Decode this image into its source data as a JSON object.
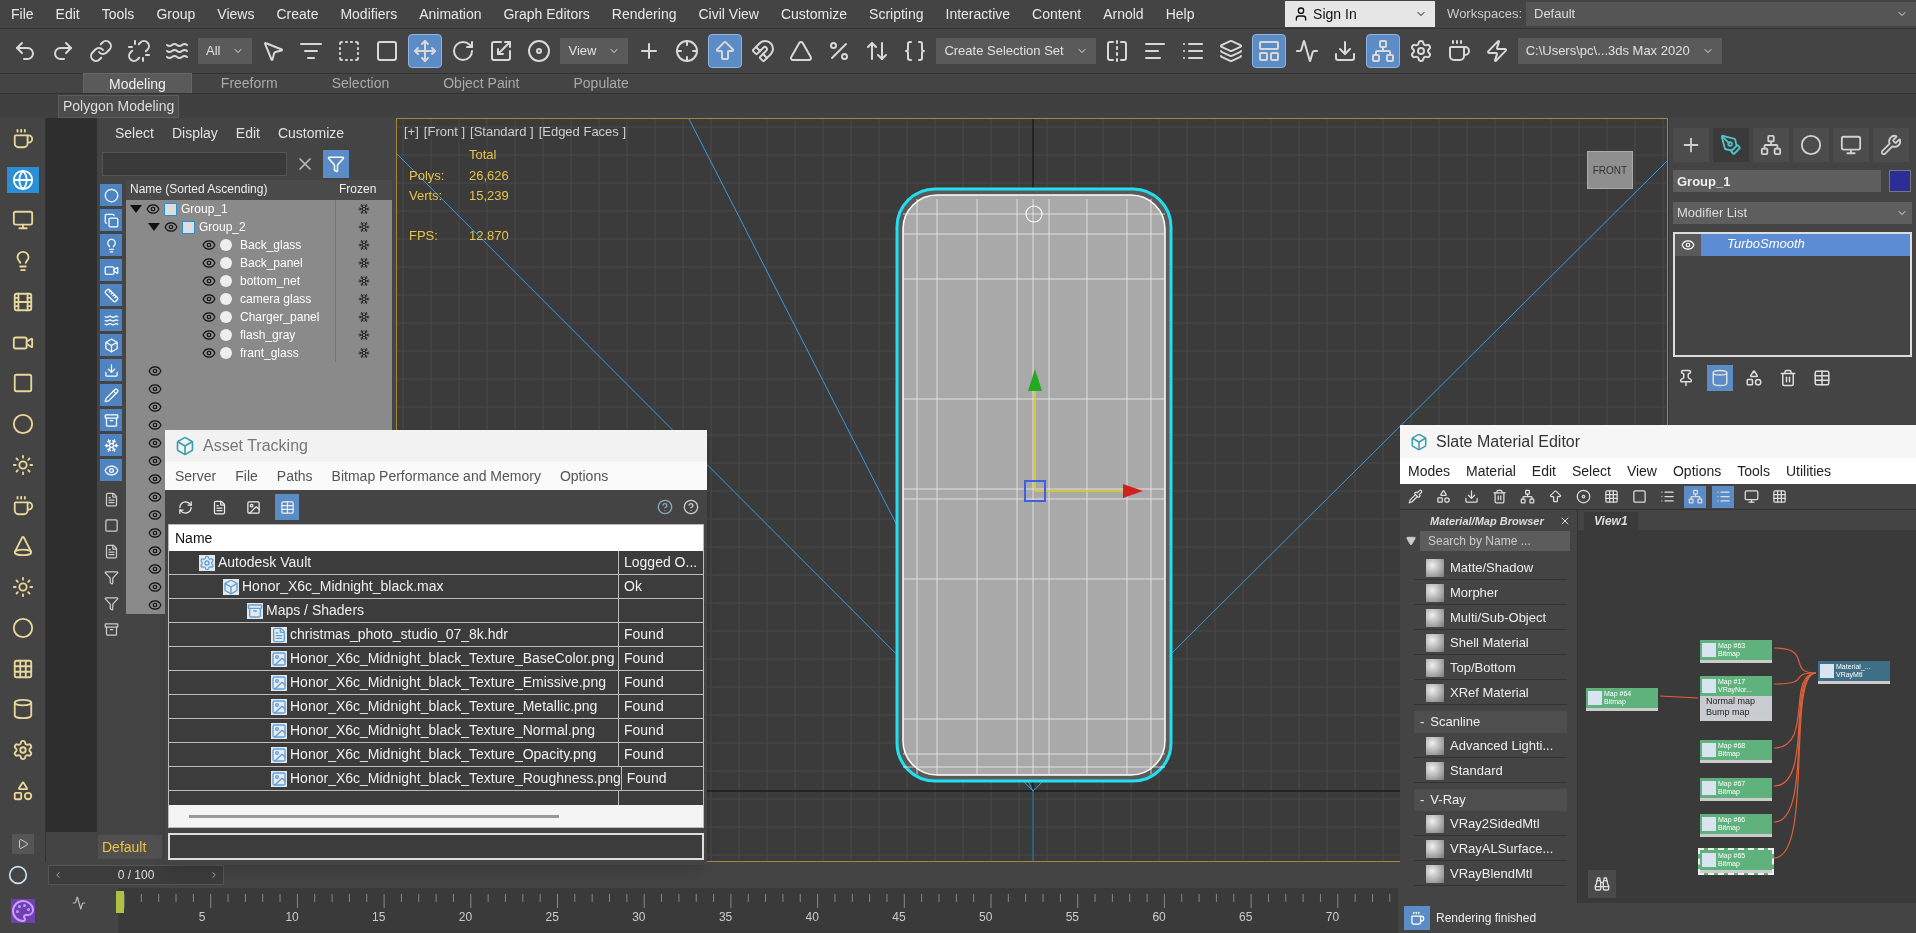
{
  "menu_bar": {
    "items": [
      "File",
      "Edit",
      "Tools",
      "Group",
      "Views",
      "Create",
      "Modifiers",
      "Animation",
      "Graph Editors",
      "Rendering",
      "Civil View",
      "Customize",
      "Scripting",
      "Interactive",
      "Content",
      "Arnold",
      "Help"
    ],
    "sign_in": "Sign In",
    "workspaces_label": "Workspaces:",
    "workspace": "Default"
  },
  "toolbar": [
    {
      "kind": "icon",
      "selected": false
    },
    {
      "kind": "icon",
      "selected": false
    },
    {
      "kind": "icon",
      "selected": false
    },
    {
      "kind": "icon",
      "selected": false
    },
    {
      "kind": "icon",
      "selected": false
    },
    {
      "kind": "dropdown",
      "value": "All"
    },
    {
      "kind": "icon",
      "selected": false
    },
    {
      "kind": "icon",
      "selected": false
    },
    {
      "kind": "icon",
      "selected": false
    },
    {
      "kind": "icon",
      "selected": false
    },
    {
      "kind": "icon",
      "selected": true
    },
    {
      "kind": "icon",
      "selected": false
    },
    {
      "kind": "icon",
      "selected": false
    },
    {
      "kind": "icon",
      "selected": false
    },
    {
      "kind": "dropdown",
      "value": "View"
    },
    {
      "kind": "icon",
      "selected": false
    },
    {
      "kind": "icon",
      "selected": false
    },
    {
      "kind": "icon",
      "selected": true
    },
    {
      "kind": "icon",
      "selected": false
    },
    {
      "kind": "icon",
      "selected": false
    },
    {
      "kind": "icon",
      "selected": false
    },
    {
      "kind": "icon",
      "selected": false
    },
    {
      "kind": "icon",
      "selected": false
    },
    {
      "kind": "dropdown",
      "value": "Create Selection Set"
    },
    {
      "kind": "icon",
      "selected": false
    },
    {
      "kind": "icon",
      "selected": false
    },
    {
      "kind": "icon",
      "selected": false
    },
    {
      "kind": "icon",
      "selected": false
    },
    {
      "kind": "icon",
      "selected": true
    },
    {
      "kind": "icon",
      "selected": false
    },
    {
      "kind": "icon",
      "selected": false
    },
    {
      "kind": "icon",
      "selected": true
    },
    {
      "kind": "icon",
      "selected": false
    },
    {
      "kind": "icon",
      "selected": false
    },
    {
      "kind": "icon",
      "selected": false
    },
    {
      "kind": "dropdown",
      "value": "C:\\Users\\pc\\...3ds Max 2020"
    }
  ],
  "ribbon": {
    "tabs": [
      {
        "label": "Modeling",
        "selected": true
      },
      {
        "label": "Freeform",
        "selected": false
      },
      {
        "label": "Selection",
        "selected": false
      },
      {
        "label": "Object Paint",
        "selected": false
      },
      {
        "label": "Populate",
        "selected": false
      }
    ],
    "panel": "Polygon Modeling"
  },
  "scene_explorer": {
    "menu": [
      "Select",
      "Display",
      "Edit",
      "Customize"
    ],
    "columns": [
      "Name (Sorted Ascending)",
      "Frozen"
    ],
    "tree": [
      {
        "name": "Group_1",
        "kind": "group",
        "expanded": true,
        "children": [
          {
            "name": "Group_2",
            "kind": "group",
            "expanded": true,
            "children": [
              {
                "name": "Back_glass",
                "kind": "object"
              },
              {
                "name": "Back_panel",
                "kind": "object"
              },
              {
                "name": "bottom_net",
                "kind": "object"
              },
              {
                "name": "camera glass",
                "kind": "object"
              },
              {
                "name": "Charger_panel",
                "kind": "object"
              },
              {
                "name": "flash_gray",
                "kind": "object"
              },
              {
                "name": "frant_glass",
                "kind": "object"
              }
            ]
          }
        ]
      }
    ],
    "layer": "Default"
  },
  "viewport": {
    "labels": [
      "[+]",
      "[Front ]",
      "[Standard ]",
      "[Edged Faces ]"
    ],
    "stats_header": "Total",
    "stats": [
      {
        "label": "Polys:",
        "value": "26,626"
      },
      {
        "label": "Verts:",
        "value": "15,239"
      },
      {
        "label": "FPS:",
        "value": "12.870"
      }
    ],
    "viewcube": "FRONT"
  },
  "command_panel": {
    "tabs": [
      {
        "selected": false
      },
      {
        "selected": true
      },
      {
        "selected": false
      },
      {
        "selected": false
      },
      {
        "selected": false
      },
      {
        "selected": false
      }
    ],
    "object_name": "Group_1",
    "modifier_list": "Modifier List",
    "modifiers": [
      {
        "name": "TurboSmooth",
        "selected": true
      }
    ]
  },
  "asset_tracking": {
    "title": "Asset Tracking",
    "menu": [
      "Server",
      "File",
      "Paths",
      "Bitmap Performance and Memory",
      "Options"
    ],
    "column": "Name",
    "rows": [
      {
        "name": "Autodesk Vault",
        "status": "Logged O...",
        "kind": "vault",
        "children": [
          {
            "name": "Honor_X6c_Midnight_black.max",
            "status": "Ok",
            "kind": "scene",
            "children": [
              {
                "name": "Maps / Shaders",
                "kind": "folder",
                "children": [
                  {
                    "name": "christmas_photo_studio_07_8k.hdr",
                    "status": "Found",
                    "kind": "hdr"
                  },
                  {
                    "name": "Honor_X6c_Midnight_black_Texture_BaseColor.png",
                    "status": "Found",
                    "kind": "image"
                  },
                  {
                    "name": "Honor_X6c_Midnight_black_Texture_Emissive.png",
                    "status": "Found",
                    "kind": "image"
                  },
                  {
                    "name": "Honor_X6c_Midnight_black_Texture_Metallic.png",
                    "status": "Found",
                    "kind": "image"
                  },
                  {
                    "name": "Honor_X6c_Midnight_black_Texture_Normal.png",
                    "status": "Found",
                    "kind": "image"
                  },
                  {
                    "name": "Honor_X6c_Midnight_black_Texture_Opacity.png",
                    "status": "Found",
                    "kind": "image"
                  },
                  {
                    "name": "Honor_X6c_Midnight_black_Texture_Roughness.png",
                    "status": "Found",
                    "kind": "image"
                  }
                ]
              }
            ]
          }
        ]
      }
    ]
  },
  "material_editor": {
    "title": "Slate Material Editor",
    "menu": [
      "Modes",
      "Material",
      "Edit",
      "Select",
      "View",
      "Options",
      "Tools",
      "Utilities"
    ],
    "browser_title": "Material/Map Browser",
    "search_placeholder": "Search by Name ...",
    "browser_items": [
      {
        "kind": "item",
        "label": "Matte/Shadow"
      },
      {
        "kind": "item",
        "label": "Morpher"
      },
      {
        "kind": "item",
        "label": "Multi/Sub-Object"
      },
      {
        "kind": "item",
        "label": "Shell Material"
      },
      {
        "kind": "item",
        "label": "Top/Bottom"
      },
      {
        "kind": "item",
        "label": "XRef Material"
      },
      {
        "kind": "group",
        "sign": "-",
        "label": "Scanline"
      },
      {
        "kind": "item",
        "label": "Advanced Lighti..."
      },
      {
        "kind": "item",
        "label": "Standard"
      },
      {
        "kind": "group",
        "sign": "-",
        "label": "V-Ray"
      },
      {
        "kind": "item",
        "label": "VRay2SidedMtl"
      },
      {
        "kind": "item",
        "label": "VRayALSurface..."
      },
      {
        "kind": "item",
        "label": "VRayBlendMtl"
      }
    ],
    "view_tab": "View1",
    "nodes": [
      {
        "title": "Map #64",
        "type": "Bitmap",
        "kind": "map"
      },
      {
        "title": "Map #63",
        "type": "Bitmap",
        "kind": "map"
      },
      {
        "title": "Map #17",
        "type": "VRayNor...",
        "kind": "map",
        "slots": [
          "Normal map",
          "Bump map"
        ]
      },
      {
        "title": "Map #68",
        "type": "Bitmap",
        "kind": "map"
      },
      {
        "title": "Map #67",
        "type": "Bitmap",
        "kind": "map"
      },
      {
        "title": "Map #66",
        "type": "Bitmap",
        "kind": "map"
      },
      {
        "title": "Map #65",
        "type": "Bitmap",
        "kind": "map",
        "selected": true
      },
      {
        "title": "Material_...",
        "type": "VRayMtl",
        "kind": "material"
      }
    ],
    "status": "Rendering finished"
  },
  "timeline": {
    "frame": "0 / 100",
    "ticks": [
      "5",
      "10",
      "15",
      "20",
      "25",
      "30",
      "35",
      "40",
      "45",
      "50",
      "55",
      "60",
      "65",
      "70"
    ]
  }
}
